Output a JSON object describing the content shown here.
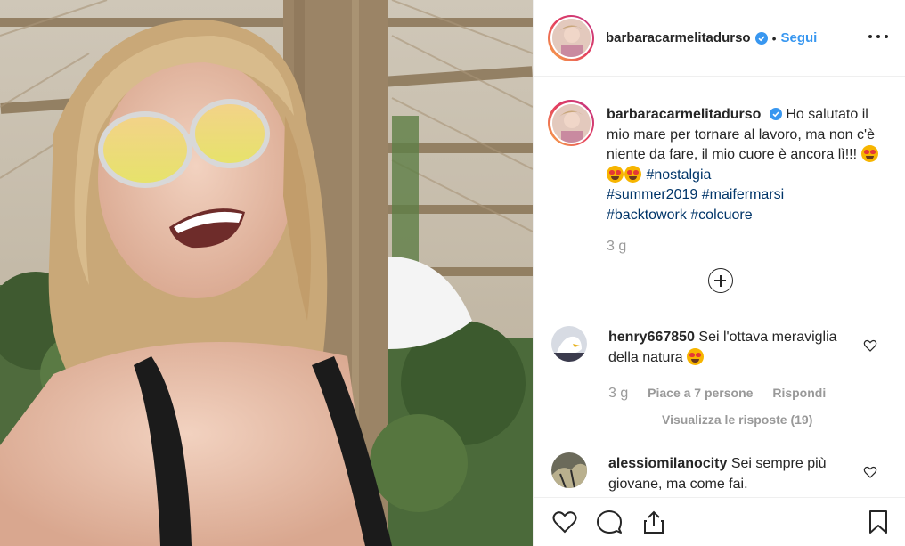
{
  "post": {
    "username": "barbaracarmelitadurso",
    "follow_label": "Segui",
    "separator": "•",
    "caption_text": "Ho salutato il mio mare per tornare al lavoro, ma non c'è niente da fare, il mio cuore è ancora lì!!!",
    "hashtags": [
      "#nostalgia",
      "#summer2019",
      "#maifermarsi",
      "#backtowork",
      "#colcuore"
    ],
    "caption_time": "3 g"
  },
  "comments": [
    {
      "username": "henry667850",
      "text": "Sei l'ottava meraviglia della natura",
      "time": "3 g",
      "likes": "Piace a 7 persone",
      "reply_label": "Rispondi",
      "view_replies": "Visualizza le risposte (19)"
    },
    {
      "username": "alessiomilanocity",
      "text": "Sei sempre più giovane, ma come fai."
    }
  ],
  "icons": {
    "verified": "verified-badge-icon",
    "more": "more-options-icon",
    "add": "load-more-comments-icon",
    "like": "heart-icon",
    "comment": "comment-icon",
    "share": "share-icon",
    "save": "bookmark-icon"
  },
  "colors": {
    "link": "#3897f0",
    "hashtag": "#003569",
    "muted": "#999999",
    "text": "#262626"
  }
}
